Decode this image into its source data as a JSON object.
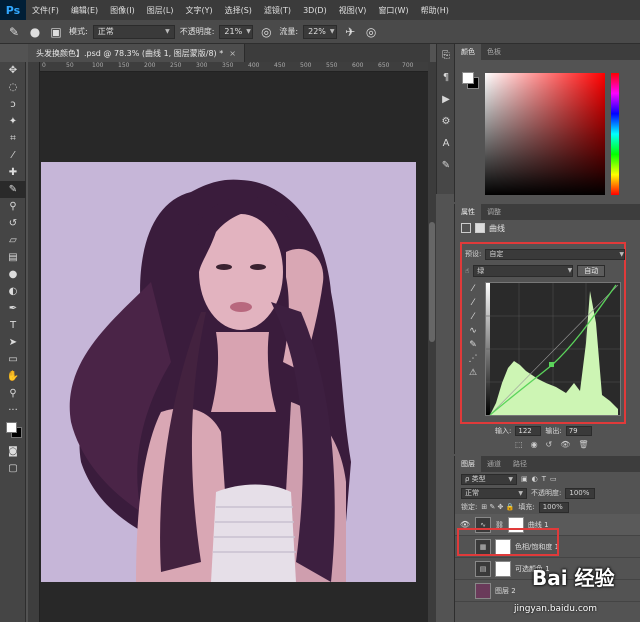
{
  "app": {
    "logo": "Ps"
  },
  "menu": [
    "文件(F)",
    "编辑(E)",
    "图像(I)",
    "图层(L)",
    "文字(Y)",
    "选择(S)",
    "滤镜(T)",
    "3D(D)",
    "视图(V)",
    "窗口(W)",
    "帮助(H)"
  ],
  "options": {
    "mode_label": "模式:",
    "mode_value": "正常",
    "opacity_label": "不透明度:",
    "opacity_value": "21%",
    "flow_label": "流量:",
    "flow_value": "22%"
  },
  "document": {
    "tab_title": "头发换颜色】.psd @ 78.3% (曲线 1, 图层蒙版/8) *",
    "close": "×"
  },
  "ruler": {
    "h_ticks": [
      "0",
      "50",
      "100",
      "150",
      "200",
      "250",
      "300",
      "350",
      "400",
      "450",
      "500",
      "550",
      "600",
      "650",
      "700"
    ]
  },
  "color_panel": {
    "tabs": [
      "颜色",
      "色板"
    ],
    "fg": "#ffffff",
    "bg": "#000000"
  },
  "properties": {
    "tabs": [
      "属性",
      "调整"
    ],
    "title": "曲线",
    "preset_label": "预设:",
    "preset_value": "自定",
    "channel_value": "绿",
    "auto_label": "自动",
    "input_label": "输入:",
    "input_value": "122",
    "output_label": "输出:",
    "output_value": "79"
  },
  "layers": {
    "tabs": [
      "图层",
      "通道",
      "路径"
    ],
    "filter_label": "ρ 类型",
    "blend_value": "正常",
    "opacity_label": "不透明度:",
    "opacity_value": "100%",
    "lock_label": "锁定:",
    "fill_label": "填充:",
    "fill_value": "100%",
    "items": [
      {
        "name": "曲线 1",
        "eye": "👁"
      },
      {
        "name": "色相/饱和度 1",
        "eye": ""
      },
      {
        "name": "可选颜色 1",
        "eye": ""
      },
      {
        "name": "图层 2",
        "eye": ""
      }
    ]
  },
  "watermark": {
    "main": "Bai 经验",
    "sub": "jingyan.baidu.com"
  },
  "accent": {
    "highlight": "#e03a3a",
    "curve": "#5bd45b",
    "histogram": "#cdf5b4"
  }
}
